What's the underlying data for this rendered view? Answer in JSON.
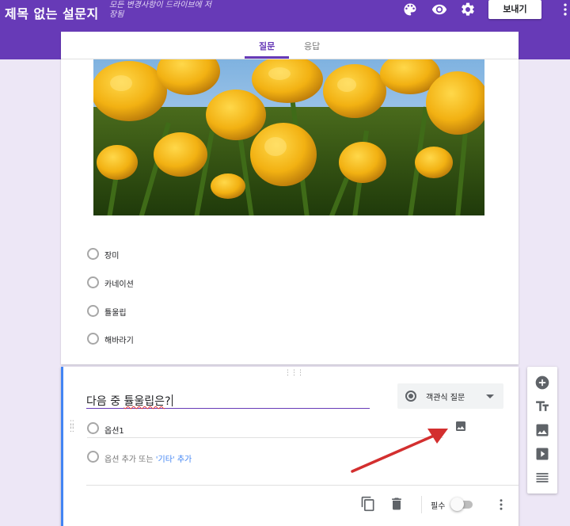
{
  "header": {
    "form_title": "제목 없는 설문지",
    "save_status": "모든 변경사항이 드라이브에 저장됨",
    "send_label": "보내기",
    "icons": [
      "palette-icon",
      "eye-icon",
      "gear-icon",
      "more-vert-icon"
    ]
  },
  "tabs": {
    "questions": "질문",
    "responses": "응답",
    "active": "질문"
  },
  "question1": {
    "image_alt": "yellow tulips photo",
    "options": [
      "장미",
      "카네이션",
      "튤울립",
      "해바라기"
    ]
  },
  "question2": {
    "title_prefix": "다음 중 ",
    "title_underlined": "튤울립은",
    "title_suffix": "?",
    "type_label": "객관식 질문",
    "option1": "옵션1",
    "add_option": "옵션 추가",
    "add_or": " 또는 ",
    "add_other": "'기타'",
    "add_other_suffix": " 추가",
    "required_label": "필수",
    "required": false
  },
  "colors": {
    "header": "#673ab7",
    "background": "#ede7f6",
    "accent_blue": "#4285f4",
    "arrow": "#d32f2f"
  }
}
